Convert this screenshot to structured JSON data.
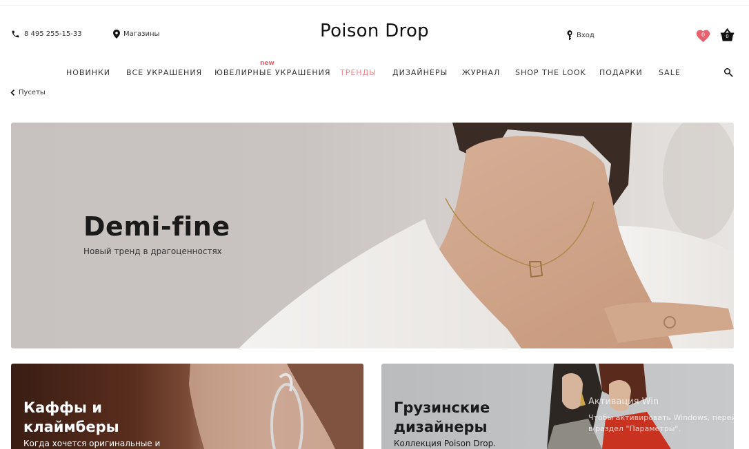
{
  "header": {
    "phone": "8 495 255-15-33",
    "stores": "Магазины",
    "logo": "Poison Drop",
    "login": "Вход",
    "favorites_count": "0",
    "cart_count": "0"
  },
  "nav": {
    "new_badge": "new",
    "items": [
      {
        "label": "НОВИНКИ"
      },
      {
        "label": "ВСЕ УКРАШЕНИЯ"
      },
      {
        "label": "ЮВЕЛИРНЫЕ УКРАШЕНИЯ"
      },
      {
        "label": "ТРЕНДЫ"
      },
      {
        "label": "ДИЗАЙНЕРЫ"
      },
      {
        "label": "ЖУРНАЛ"
      },
      {
        "label": "SHOP THE LOOK"
      },
      {
        "label": "ПОДАРКИ"
      },
      {
        "label": "SALE"
      }
    ],
    "active_color": "#e8878f"
  },
  "breadcrumb": {
    "label": "Пусеты"
  },
  "hero": {
    "title": "Demi-fine",
    "subtitle": "Новый тренд в драгоценностях"
  },
  "cards": [
    {
      "title_line1": "Каффы и",
      "title_line2": "клаймберы",
      "subtitle": "Когда хочется оригинальные и"
    },
    {
      "title_line1": "Грузинские",
      "title_line2": "дизайнеры",
      "subtitle": "Коллекция Poison Drop.",
      "overlay_1": "Активация Win",
      "overlay_2": "Чтобы активировать Windows, перейдите",
      "overlay_3": "в раздел \"Параметры\"."
    }
  ],
  "colors": {
    "accent_pink": "#e8606b",
    "text": "#333333"
  }
}
